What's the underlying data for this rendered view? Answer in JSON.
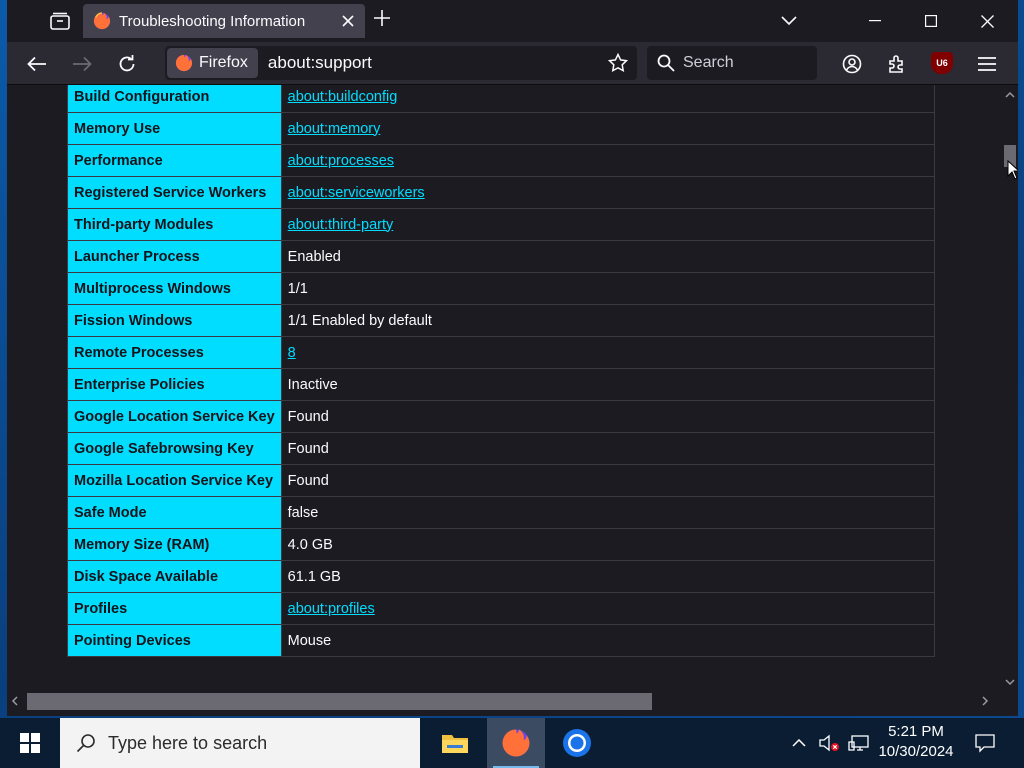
{
  "browser": {
    "tab_title": "Troubleshooting Information",
    "identity_label": "Firefox",
    "url": "about:support",
    "search_placeholder": "Search",
    "ublock_badge": "U6"
  },
  "support_table": [
    {
      "key": "Build Configuration",
      "value": "about:buildconfig",
      "link": true
    },
    {
      "key": "Memory Use",
      "value": "about:memory",
      "link": true
    },
    {
      "key": "Performance",
      "value": "about:processes",
      "link": true
    },
    {
      "key": "Registered Service Workers",
      "value": "about:serviceworkers",
      "link": true
    },
    {
      "key": "Third-party Modules",
      "value": "about:third-party",
      "link": true
    },
    {
      "key": "Launcher Process",
      "value": "Enabled",
      "link": false
    },
    {
      "key": "Multiprocess Windows",
      "value": "1/1",
      "link": false
    },
    {
      "key": "Fission Windows",
      "value": "1/1 Enabled by default",
      "link": false
    },
    {
      "key": "Remote Processes",
      "value": "8",
      "link": true
    },
    {
      "key": "Enterprise Policies",
      "value": "Inactive",
      "link": false
    },
    {
      "key": "Google Location Service Key",
      "value": "Found",
      "link": false
    },
    {
      "key": "Google Safebrowsing Key",
      "value": "Found",
      "link": false
    },
    {
      "key": "Mozilla Location Service Key",
      "value": "Found",
      "link": false
    },
    {
      "key": "Safe Mode",
      "value": "false",
      "link": false
    },
    {
      "key": "Memory Size (RAM)",
      "value": "4.0 GB",
      "link": false
    },
    {
      "key": "Disk Space Available",
      "value": "61.1 GB",
      "link": false
    },
    {
      "key": "Profiles",
      "value": "about:profiles",
      "link": true
    },
    {
      "key": "Pointing Devices",
      "value": "Mouse",
      "link": false
    }
  ],
  "taskbar": {
    "search_placeholder": "Type here to search",
    "time": "5:21 PM",
    "date": "10/30/2024",
    "apps": [
      "file-explorer-icon",
      "firefox-icon",
      "chrome-icon"
    ]
  },
  "colors": {
    "key_cell": "#00ddff",
    "link": "#00ddff",
    "page_bg": "#1c1b22",
    "toolbar_bg": "#2b2a33"
  }
}
